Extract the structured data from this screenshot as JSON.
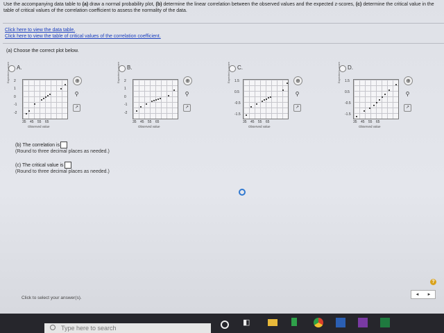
{
  "instructions": {
    "pre_a": "Use the accompanying data table to ",
    "a": "(a)",
    "a_text": " draw a normal probability plot, ",
    "b": "(b)",
    "b_text": " determine the linear correlation between the observed values and the expected z-scores, ",
    "c": "(c)",
    "c_text": " determine the critical value in the table of critical values of the correlation coefficient to assess the normality of the data."
  },
  "links": {
    "data_table": "Click here to view the data table.",
    "critical_table": "Click here to view the table of critical values of the correlation coefficient."
  },
  "part_a": {
    "prompt": "(a) Choose the correct plot below.",
    "options": [
      {
        "label": "A.",
        "yticks": [
          "2",
          "1",
          "0",
          "-1",
          "-2"
        ]
      },
      {
        "label": "B.",
        "yticks": [
          "2",
          "1",
          "0",
          "-1",
          "-2"
        ]
      },
      {
        "label": "C.",
        "yticks": [
          "1.5",
          "0.5",
          "-0.5",
          "-1.5"
        ]
      },
      {
        "label": "D.",
        "yticks": [
          "1.5",
          "0.5",
          "-0.5",
          "-1.5"
        ]
      }
    ],
    "ylabel": "Expected z-score",
    "xticks": "35 45 55 65",
    "xlabel": "Observed value"
  },
  "part_b": {
    "prompt": "(b) The correlation is",
    "hint": "(Round to three decimal places as needed.)"
  },
  "part_c": {
    "prompt": "(c) The critical value is",
    "hint": "(Round to three decimal places as needed.)"
  },
  "footer": {
    "text": "Click to select your answer(s).",
    "help": "?",
    "prev": "◄",
    "next": "►"
  },
  "taskbar": {
    "search_placeholder": "Type here to search"
  },
  "icons": [
    "zoom-in-icon",
    "zoom-out-icon",
    "expand-icon",
    "search-icon",
    "task-view-icon",
    "file-explorer-icon",
    "chrome-icon",
    "word-icon",
    "onenote-icon",
    "excel-icon"
  ],
  "colors": {
    "link": "#1b3fbf",
    "spinner": "#2f78d0",
    "help": "#d9a21c"
  }
}
